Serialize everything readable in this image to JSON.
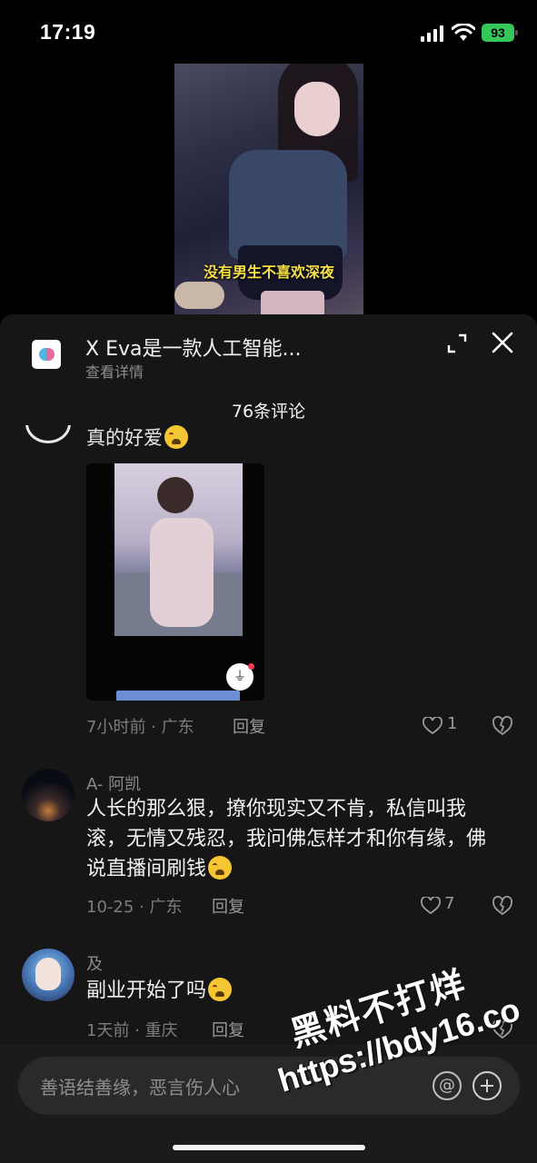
{
  "status_bar": {
    "time": "17:19",
    "battery": "93"
  },
  "video": {
    "caption": "没有男生不喜欢深夜"
  },
  "panel": {
    "app_title": "X Eva是一款人工智能...",
    "app_subtitle": "查看详情",
    "comments_count": "76条评论"
  },
  "comments": [
    {
      "partial_text": "真的好爱",
      "meta": "7小时前 · 广东",
      "reply_label": "回复",
      "likes": "1"
    },
    {
      "username": "A- 阿凯",
      "text": "人长的那么狠，撩你现实又不肯，私信叫我滚，无情又残忍，我问佛怎样才和你有缘，佛说直播间刷钱",
      "meta": "10-25 · 广东",
      "reply_label": "回复",
      "likes": "7"
    },
    {
      "username": "及",
      "text": "副业开始了吗",
      "meta": "1天前 · 重庆",
      "reply_label": "回复",
      "likes": ""
    }
  ],
  "input": {
    "placeholder": "善语结善缘，恶言伤人心"
  },
  "watermark": {
    "line1": "黑料不打烊",
    "line2": "https://bdy16.co"
  }
}
